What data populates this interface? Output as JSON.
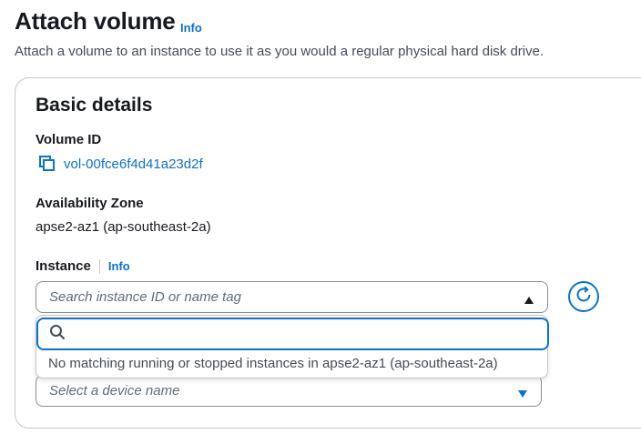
{
  "header": {
    "title": "Attach volume",
    "info": "Info",
    "description": "Attach a volume to an instance to use it as you would a regular physical hard disk drive."
  },
  "card": {
    "title": "Basic details"
  },
  "volume": {
    "label": "Volume ID",
    "id": "vol-00fce6f4d41a23d2f",
    "icon": "copy-icon"
  },
  "az": {
    "label": "Availability Zone",
    "value": "apse2-az1 (ap-southeast-2a)"
  },
  "instance": {
    "label": "Instance",
    "info": "Info",
    "placeholder": "Search instance ID or name tag",
    "search_value": "",
    "empty_message": "No matching running or stopped instances in apse2-az1 (ap-southeast-2a)"
  },
  "device": {
    "placeholder": "Select a device name"
  },
  "colors": {
    "link": "#0972d3",
    "text": "#16191f",
    "border": "#8c8c94"
  }
}
